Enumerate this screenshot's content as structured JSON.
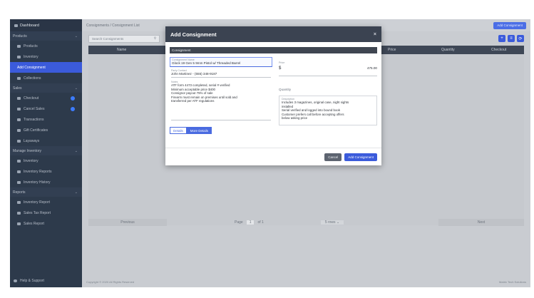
{
  "sidebar": {
    "brand": "Dashboard",
    "sections": [
      {
        "label": "Products",
        "items": [
          "Products",
          "Inventory",
          "Add Consignment",
          "Collections"
        ]
      },
      {
        "label": "Sales",
        "items": [
          "Checkout",
          "Cancel Sales",
          "Transactions",
          "Gift Certificates",
          "Layaways"
        ]
      },
      {
        "label": "Manage Inventory",
        "items": [
          "Inventory",
          "Inventory Reports",
          "Inventory History"
        ]
      },
      {
        "label": "Reports",
        "items": [
          "Inventory Report",
          "Sales Tax Report",
          "Sales Report"
        ]
      }
    ],
    "bottom": "Help & Support",
    "active_item": "Add Consignment"
  },
  "topbar": {
    "breadcrumb": "Consignments / Consignment List",
    "action_button": "Add Consignment"
  },
  "toolbar": {
    "search_placeholder": "Search Consignments",
    "buttons": [
      "+",
      "≡",
      "⟳"
    ]
  },
  "table": {
    "headers": [
      "Name",
      "Price",
      "Quantity",
      "Checkout"
    ]
  },
  "pager": {
    "prev": "Previous",
    "page_label": "Page",
    "page_value": "1",
    "of_label": "of 1",
    "rows": "5 rows",
    "next": "Next"
  },
  "footer": {
    "left": "Copyright © 2020 All Rights Reserved",
    "right": "Matrix Tech Solutions"
  },
  "modal": {
    "title": "Add Consignment",
    "close": "×",
    "section_title": "Consignment",
    "consignment_name_label": "Consignment Name",
    "consignment_name_value": "Glock 19 Gen 5 9mm Pistol w/ Threaded Barrel",
    "party_contact_label": "Party Contact",
    "party_contact_value": "John Martinez - (555) 348-9187",
    "price_label": "Price",
    "price_currency": "$",
    "price_value": "475.00",
    "quantity_label": "Quantity",
    "notes_label": "Notes",
    "notes_value_lines": [
      "ATF form 4473 completed, serial # verified",
      "Minimum acceptable price $400",
      "Consignor payout 75% of sale",
      "Firearm must remain on premises until sold and",
      "transferred per ATF regulations"
    ],
    "description_label": "Description",
    "description_value_lines": [
      "Includes 3 magazines, original case, night sights",
      "installed",
      "Serial verified and logged into bound book",
      "Customer prefers call before accepting offers",
      "below asking price"
    ],
    "tab_inactive": "Details",
    "tab_active": "More Details",
    "cancel_button": "Cancel",
    "add_button": "Add Consignment"
  }
}
